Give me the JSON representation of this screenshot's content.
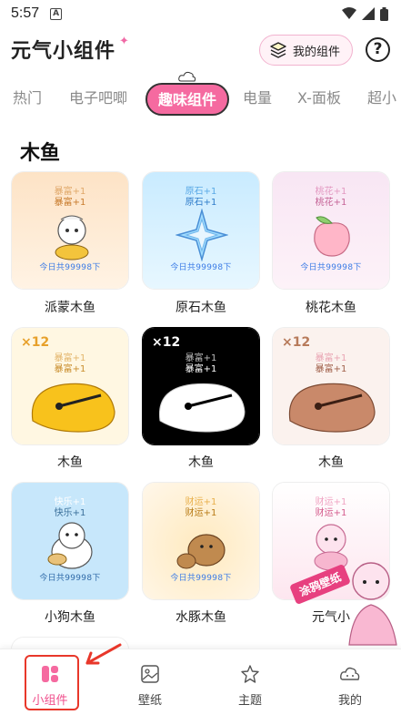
{
  "status_bar": {
    "time": "5:57",
    "notif_letter": "A"
  },
  "header": {
    "app_title": "元气小组件",
    "my_widgets_label": "我的组件",
    "help_label": "?"
  },
  "tabs": [
    {
      "label": "热门"
    },
    {
      "label": "电子吧唧"
    },
    {
      "label": "趣味组件",
      "active": true
    },
    {
      "label": "电量"
    },
    {
      "label": "X-面板"
    },
    {
      "label": "超小"
    }
  ],
  "section": {
    "title": "木鱼"
  },
  "cards": [
    {
      "name": "派蒙木鱼",
      "line1": "暴富+1",
      "line2": "暴富+1",
      "count": "今日共99998下",
      "bg": "#fde3c6"
    },
    {
      "name": "原石木鱼",
      "line1": "原石+1",
      "line2": "原石+1",
      "count": "今日共99998下",
      "bg": "#cfeeff"
    },
    {
      "name": "桃花木鱼",
      "line1": "桃花+1",
      "line2": "桃花+1",
      "count": "今日共99998下",
      "bg": "#fbe9f4"
    },
    {
      "name": "木鱼",
      "mult": "×12",
      "line1": "暴富+1",
      "line2": "暴富+1",
      "bg": "#fff7e0"
    },
    {
      "name": "木鱼",
      "mult": "×12",
      "line1": "暴富+1",
      "line2": "暴富+1",
      "bg": "#000000"
    },
    {
      "name": "木鱼",
      "mult": "×12",
      "line1": "暴富+1",
      "line2": "暴富+1",
      "bg": "#fbf3ef"
    },
    {
      "name": "小狗木鱼",
      "line1": "快乐+1",
      "line2": "快乐+1",
      "count": "今日共99998下",
      "bg": "#c7e7fb"
    },
    {
      "name": "水豚木鱼",
      "line1": "财运+1",
      "line2": "财运+1",
      "count": "今日共99998下",
      "bg": "#fff6e4"
    },
    {
      "name": "元气小",
      "line1": "财运+1",
      "line2": "财运+1",
      "bg": "#fdeef4"
    }
  ],
  "promo": {
    "label": "涂鸦壁纸"
  },
  "bottom_nav": [
    {
      "label": "小组件",
      "icon": "widgets-icon",
      "active": true
    },
    {
      "label": "壁纸",
      "icon": "wallpaper-icon"
    },
    {
      "label": "主题",
      "icon": "theme-icon"
    },
    {
      "label": "我的",
      "icon": "profile-icon"
    }
  ],
  "colors": {
    "accent": "#f56aa0",
    "active_nav": "#f04f8c",
    "highlight": "#e8372a"
  }
}
